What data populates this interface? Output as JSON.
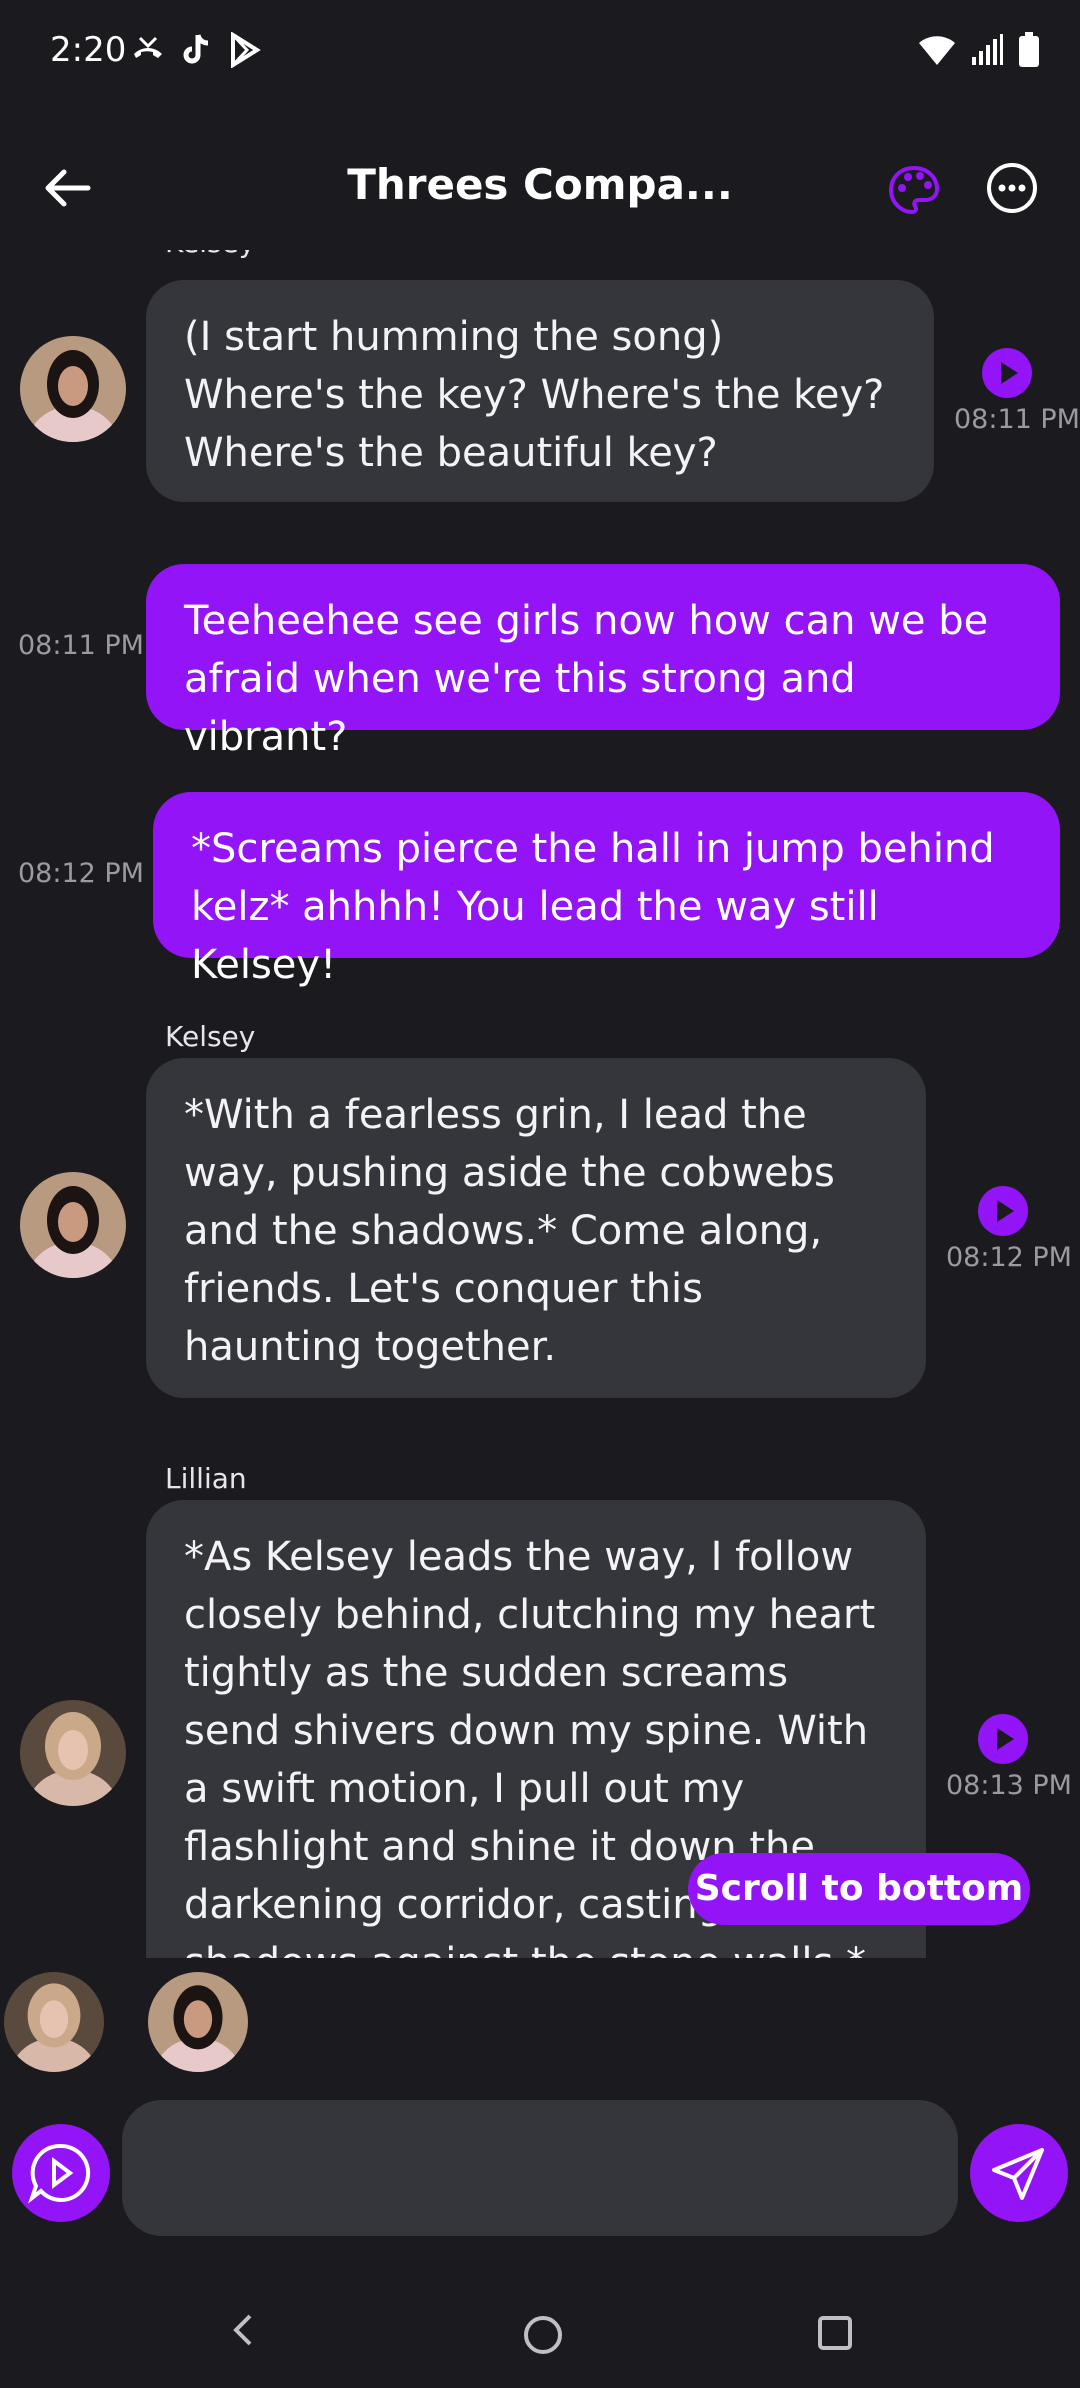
{
  "status_bar": {
    "time": "2:20"
  },
  "header": {
    "title": "Threes Compa..."
  },
  "messages": [
    {
      "sender": "Kelsey",
      "text": "(I start humming the song) Where's the key? Where's the key? Where's the beautiful key?",
      "time": "08:11 PM"
    },
    {
      "text": "Teeheehee see girls now how can we be afraid when we're this strong and vibrant?",
      "time": "08:11 PM"
    },
    {
      "text": "*Screams pierce the hall in jump behind kelz* ahhhh! You lead the way still Kelsey!",
      "time": "08:12 PM"
    },
    {
      "sender": "Kelsey",
      "text": "*With a fearless grin, I lead the way, pushing aside the cobwebs and the shadows.* Come along, friends. Let's conquer this haunting together.",
      "time": "08:12 PM"
    },
    {
      "sender": "Lillian",
      "text": "*As Kelsey leads the way, I follow closely behind, clutching my heart tightly as the sudden screams send shivers down my spine. With a swift motion, I pull out my flashlight and shine it down the darkening corridor, casting eerie shadows against the stone walls.*",
      "time": "08:13 PM"
    }
  ],
  "scroll_button": "Scroll to bottom",
  "input": {
    "value": ""
  },
  "colors": {
    "accent": "#9214f7",
    "background": "#1b1b1f",
    "incoming_bubble": "#35363c"
  }
}
